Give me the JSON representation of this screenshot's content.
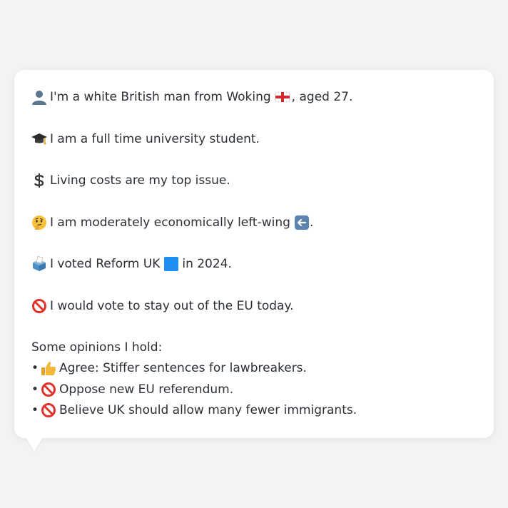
{
  "profile": {
    "identity": {
      "icon": "person-silhouette-icon",
      "text_before": "I'm a white British man from Woking",
      "flag_icon": "england-flag-icon",
      "text_after": ", aged 27."
    },
    "occupation": {
      "icon": "graduation-cap-icon",
      "text": "I am a full time university student."
    },
    "top_issue": {
      "icon": "dollar-sign-icon",
      "text": "Living costs are my top issue."
    },
    "economics": {
      "icon": "thinking-face-icon",
      "text_before": "I am moderately economically left-wing",
      "arrow_icon": "left-arrow-icon",
      "text_after": "."
    },
    "vote_2024": {
      "icon": "ballot-box-icon",
      "text_before": "I voted Reform UK",
      "party_icon": "blue-square-icon",
      "text_after": "in 2024."
    },
    "eu_vote": {
      "icon": "prohibited-icon",
      "text": "I would vote to stay out of the EU today."
    }
  },
  "opinions": {
    "heading": "Some opinions I hold:",
    "bullet": "•",
    "items": [
      {
        "icon": "thumbs-up-icon",
        "text": "Agree: Stiffer sentences for lawbreakers."
      },
      {
        "icon": "prohibited-icon",
        "text": "Oppose new EU referendum."
      },
      {
        "icon": "prohibited-icon",
        "text": "Believe UK should allow many fewer immigrants."
      }
    ]
  },
  "colors": {
    "background": "#f2f3f5",
    "card": "#ffffff",
    "text": "#2b2f36",
    "prohibited_red": "#e0312b",
    "party_blue": "#1f8ef1",
    "thumbs_yellow": "#f4b73a"
  }
}
